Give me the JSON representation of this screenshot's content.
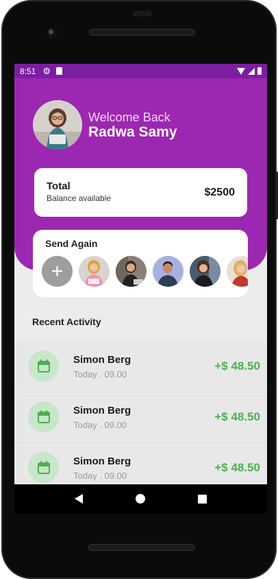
{
  "status_bar": {
    "time": "8:51"
  },
  "header": {
    "welcome": "Welcome Back",
    "name": "Radwa Samy"
  },
  "balance": {
    "title": "Total",
    "subtitle": "Balance available",
    "amount": "$2500"
  },
  "send_again": {
    "title": "Send Again",
    "add_icon": "plus-icon",
    "contacts": [
      "contact-1",
      "contact-2",
      "contact-3",
      "contact-4",
      "contact-5"
    ]
  },
  "recent": {
    "title": "Recent Activity",
    "items": [
      {
        "name": "Simon Berg",
        "time": "Today . 09.00",
        "amount": "+$ 48.50",
        "icon": "calendar-icon"
      },
      {
        "name": "Simon Berg",
        "time": "Today . 09.00",
        "amount": "+$ 48.50",
        "icon": "calendar-icon"
      },
      {
        "name": "Simon Berg",
        "time": "Today . 09.00",
        "amount": "+$ 48.50",
        "icon": "calendar-icon"
      }
    ]
  },
  "colors": {
    "primary": "#9c27b0",
    "status_bar": "#7b1fa2",
    "positive": "#4caf50",
    "icon_bg": "#c8e6c9"
  }
}
